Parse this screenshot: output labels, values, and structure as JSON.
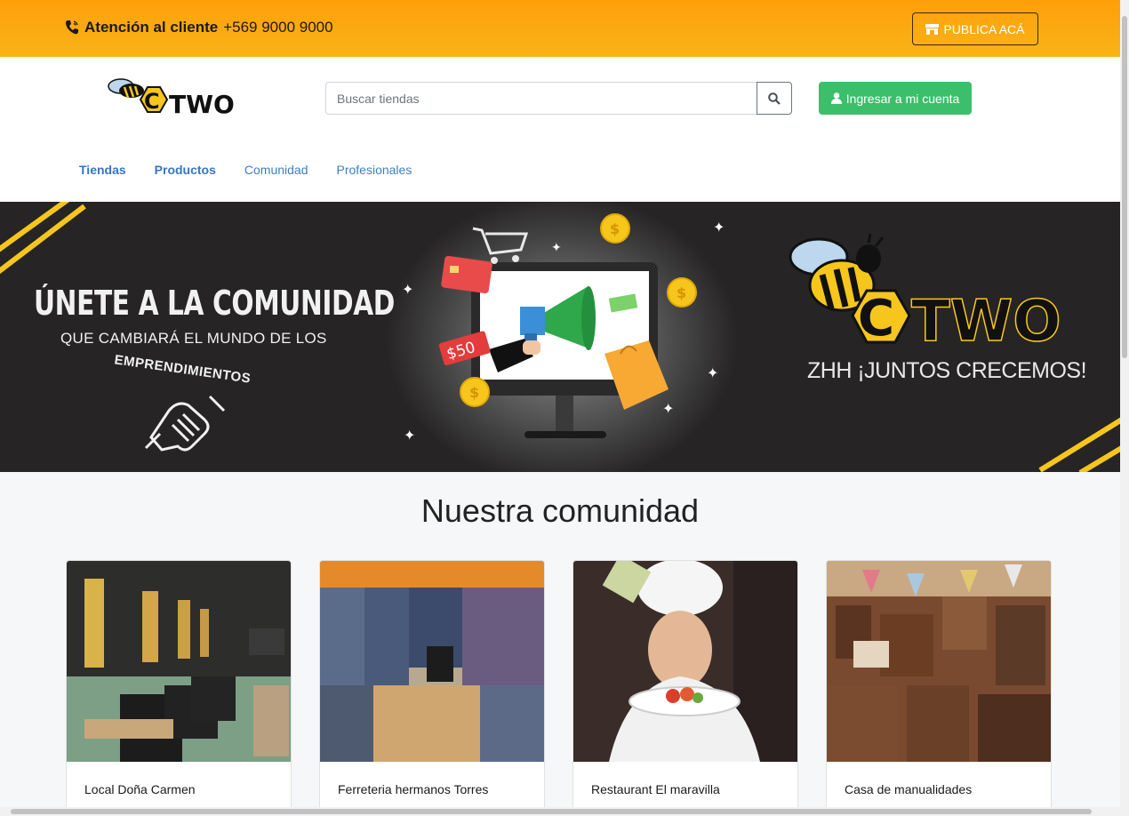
{
  "topbar": {
    "contact_label": "Atención al cliente",
    "contact_phone": "+569 9000 9000",
    "publish_label": "PUBLICA ACÁ"
  },
  "header": {
    "logo_text": "TWO",
    "logo_letter": "C",
    "search_placeholder": "Buscar tiendas",
    "login_label": "Ingresar a mi cuenta"
  },
  "nav": {
    "items": [
      "Tiendas",
      "Productos",
      "Comunidad",
      "Profesionales"
    ]
  },
  "banner": {
    "title": "ÚNETE A LA COMUNIDAD",
    "subtitle": "QUE CAMBIARÁ EL MUNDO  DE LOS",
    "emprend": "EMPRENDIMIENTOS",
    "price_tag": "$50",
    "logo_letter": "C",
    "logo_text": "TWO",
    "slogan": "ZHH ¡JUNTOS CRECEMOS!"
  },
  "section": {
    "title": "Nuestra comunidad"
  },
  "cards": [
    {
      "name": "Local Doña Carmen"
    },
    {
      "name": "Ferreteria hermanos Torres"
    },
    {
      "name": "Restaurant El maravilla"
    },
    {
      "name": "Casa de manualidades"
    }
  ],
  "colors": {
    "topbar": "#ff9f0a",
    "login": "#3bbf6a",
    "nav_link": "#3d7fc4",
    "banner_bg": "#262424",
    "brand_yellow": "#f7c61c"
  }
}
